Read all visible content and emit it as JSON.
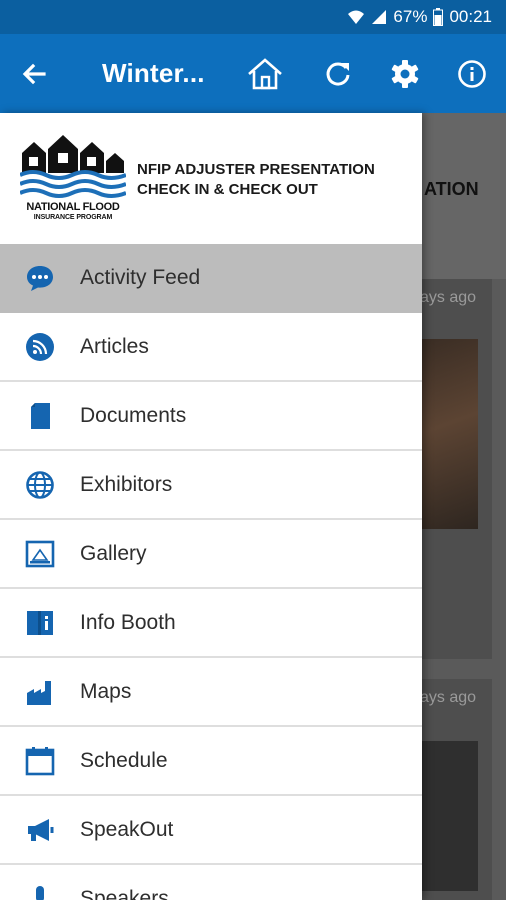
{
  "status_bar": {
    "battery": "67%",
    "time": "00:21"
  },
  "app_bar": {
    "title": "Winter..."
  },
  "drawer": {
    "logo_name": "NATIONAL FLOOD",
    "logo_sub": "INSURANCE PROGRAM",
    "event_title_line1": "NFIP ADJUSTER PRESENTATION",
    "event_title_line2": "CHECK IN & CHECK OUT",
    "menu": [
      {
        "label": "Activity Feed",
        "icon": "chat-bubble-icon"
      },
      {
        "label": "Articles",
        "icon": "rss-icon"
      },
      {
        "label": "Documents",
        "icon": "document-icon"
      },
      {
        "label": "Exhibitors",
        "icon": "globe-icon"
      },
      {
        "label": "Gallery",
        "icon": "image-icon"
      },
      {
        "label": "Info Booth",
        "icon": "book-icon"
      },
      {
        "label": "Maps",
        "icon": "factory-icon"
      },
      {
        "label": "Schedule",
        "icon": "calendar-icon"
      },
      {
        "label": "SpeakOut",
        "icon": "megaphone-icon"
      },
      {
        "label": "Speakers",
        "icon": "person-icon"
      }
    ]
  },
  "background": {
    "header_fragment": "ATION",
    "time_fragment_1": "ays ago",
    "time_fragment_2": "ays ago"
  },
  "colors": {
    "accent": "#0d6fbd",
    "status_bar": "#0b5fa0",
    "active_row": "#bcbcbc",
    "icon": "#1565b0"
  }
}
